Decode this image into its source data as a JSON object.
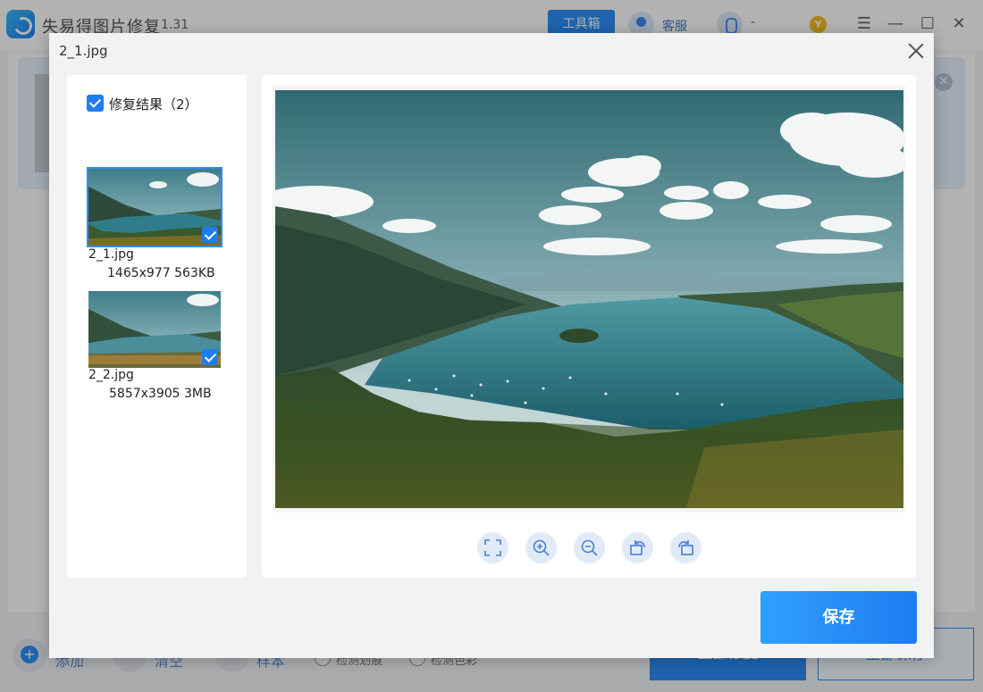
{
  "app": {
    "title": "失易得图片修复",
    "version": "1.31",
    "toolbox_label": "工具箱",
    "service_label": "客服",
    "qq_label": "-",
    "vip_label": "Y"
  },
  "background": {
    "add_label": "添加",
    "clear_label": "清空",
    "sample_label": "样本",
    "detect_scratch_label": "检测划痕",
    "detect_color_label": "检测色彩",
    "repair_all_label": "全部修复",
    "save_all_label": "全部保存"
  },
  "dialog": {
    "title": "2_1.jpg",
    "results_label": "修复结果（2）",
    "results": [
      {
        "name": "2_1.jpg",
        "dims": "1465x977",
        "size": "563KB",
        "checked": true,
        "selected": true
      },
      {
        "name": "2_2.jpg",
        "dims": "5857x3905",
        "size": "3MB",
        "checked": true,
        "selected": false
      }
    ],
    "tools": [
      "fit-screen-icon",
      "zoom-in-icon",
      "zoom-out-icon",
      "rotate-left-icon",
      "rotate-right-icon"
    ],
    "save_label": "保存"
  },
  "colors": {
    "accent": "#2b8ef7"
  }
}
